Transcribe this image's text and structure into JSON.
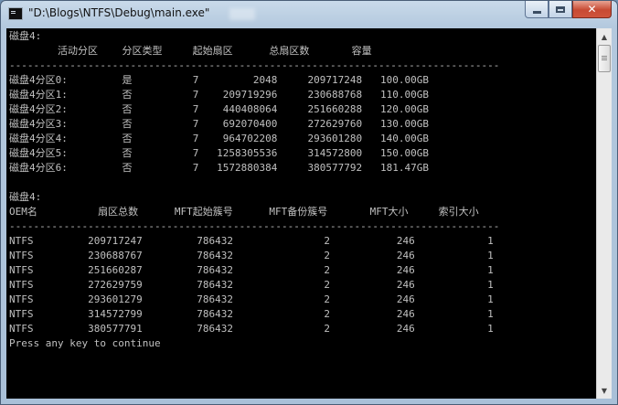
{
  "window": {
    "title": "\"D:\\Blogs\\NTFS\\Debug\\main.exe\"",
    "minimize_icon": "minimize-icon",
    "maximize_icon": "maximize-icon",
    "close_icon": "close-icon",
    "close_label": "✕"
  },
  "console": {
    "lines": [
      "磁盘4:",
      "        活动分区    分区类型     起始扇区      总扇区数       容量",
      "---------------------------------------------------------------------------------",
      "磁盘4分区0:         是          7         2048     209717248   100.00GB",
      "磁盘4分区1:         否          7    209719296     230688768   110.00GB",
      "磁盘4分区2:         否          7    440408064     251660288   120.00GB",
      "磁盘4分区3:         否          7    692070400     272629760   130.00GB",
      "磁盘4分区4:         否          7    964702208     293601280   140.00GB",
      "磁盘4分区5:         否          7   1258305536     314572800   150.00GB",
      "磁盘4分区6:         否          7   1572880384     380577792   181.47GB",
      "",
      "磁盘4:",
      "OEM名          扇区总数      MFT起始簇号      MFT备份簇号       MFT大小     索引大小",
      "---------------------------------------------------------------------------------",
      "NTFS         209717247         786432               2           246            1",
      "NTFS         230688767         786432               2           246            1",
      "NTFS         251660287         786432               2           246            1",
      "NTFS         272629759         786432               2           246            1",
      "NTFS         293601279         786432               2           246            1",
      "NTFS         314572799         786432               2           246            1",
      "NTFS         380577791         786432               2           246            1",
      "Press any key to continue"
    ]
  },
  "scrollbar": {
    "up_icon": "scroll-up-arrow-icon",
    "down_icon": "scroll-down-arrow-icon",
    "up_glyph": "▲",
    "down_glyph": "▼"
  }
}
